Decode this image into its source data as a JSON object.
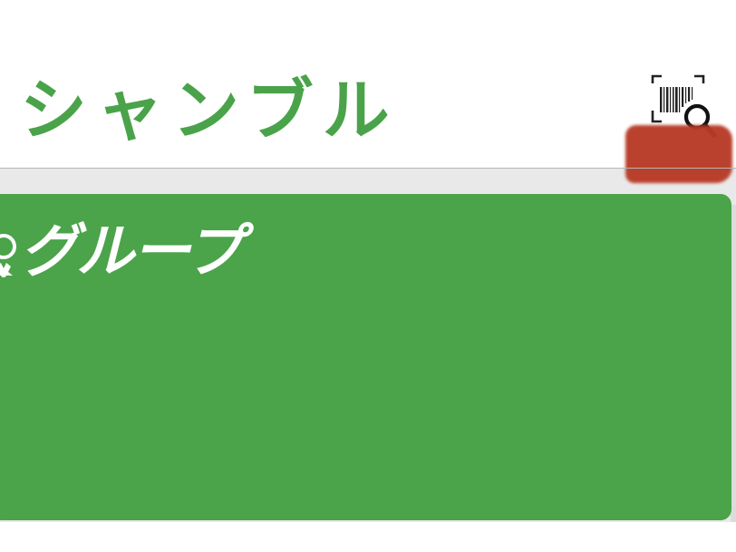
{
  "header": {
    "title": "シャンブル",
    "scan_icon": "barcode-search-icon"
  },
  "banner": {
    "logo_text": "グループ",
    "logo_icon": "star-logo-icon"
  },
  "colors": {
    "brand_green": "#4aa34a",
    "banner_green": "#4ba34a",
    "redaction_red": "#b83a26",
    "divider": "#b6b6b6"
  }
}
